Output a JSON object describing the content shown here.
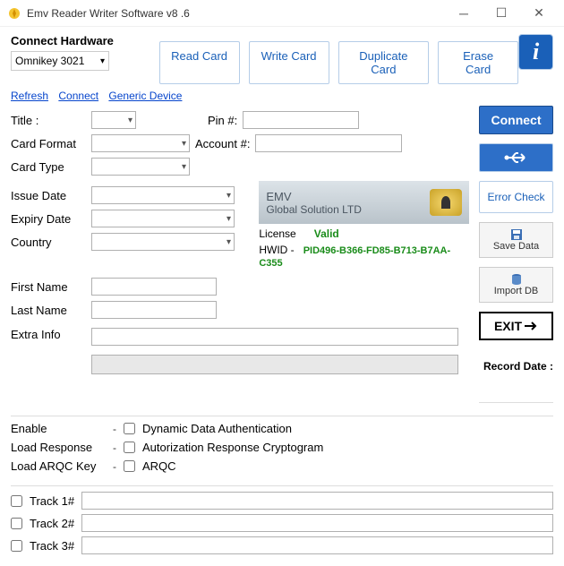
{
  "window": {
    "title": "Emv Reader Writer Software v8 .6"
  },
  "hardware": {
    "heading": "Connect Hardware",
    "selected": "Omnikey 3021",
    "links": {
      "refresh": "Refresh",
      "connect": "Connect",
      "generic": "Generic Device"
    }
  },
  "toolbar": {
    "read": "Read Card",
    "write": "Write Card",
    "duplicate": "Duplicate Card",
    "erase": "Erase Card"
  },
  "form": {
    "title_label": "Title :",
    "pin_label": "Pin #:",
    "card_format_label": "Card Format",
    "account_label": "Account #:",
    "card_type_label": "Card Type",
    "issue_date_label": "Issue Date",
    "expiry_date_label": "Expiry Date",
    "country_label": "Country",
    "first_name_label": "First Name",
    "last_name_label": "Last Name",
    "extra_info_label": "Extra Info"
  },
  "banner": {
    "line1": "EMV",
    "line2": "Global Solution LTD"
  },
  "license": {
    "label": "License",
    "status": "Valid"
  },
  "hwid": {
    "label": "HWID -",
    "value": "PID496-B366-FD85-B713-B7AA-C355"
  },
  "right": {
    "connect": "Connect",
    "error_check": "Error Check",
    "save_data": "Save Data",
    "import_db": "Import DB",
    "exit": "EXIT",
    "record_date": "Record Date :"
  },
  "options": {
    "enable_label": "Enable",
    "load_response_label": "Load Response",
    "load_arqc_label": "Load ARQC Key",
    "dda": "Dynamic Data Authentication",
    "arc": "Autorization Response Cryptogram",
    "arqc": "ARQC"
  },
  "tracks": {
    "t1": "Track 1#",
    "t2": "Track 2#",
    "t3": "Track 3#"
  }
}
